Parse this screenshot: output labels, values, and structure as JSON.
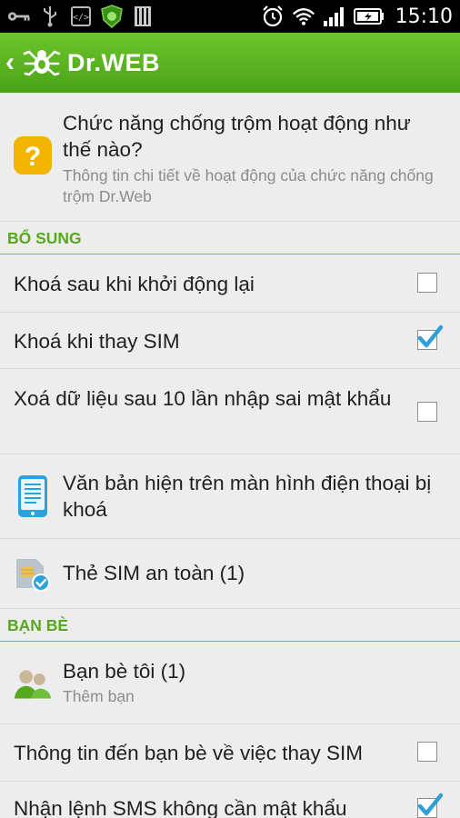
{
  "status_bar": {
    "time": "15:10",
    "left_icons": [
      "key-icon",
      "usb-icon",
      "code-icon",
      "drweb-shield-icon",
      "storage-icon"
    ],
    "right_icons": [
      "alarm-icon",
      "wifi-icon",
      "signal-icon",
      "battery-icon"
    ]
  },
  "action_bar": {
    "brand": "Dr.WEB",
    "back_glyph": "‹"
  },
  "help_item": {
    "title": "Chức năng chống trộm hoạt động như thế nào?",
    "subtitle": "Thông tin chi tiết về hoạt động của chức năng chống trộm Dr.Web"
  },
  "sections": {
    "extra": "BỔ SUNG",
    "friends": "BẠN BÈ"
  },
  "settings": [
    {
      "label": "Khoá sau khi khởi động lại",
      "checked": false
    },
    {
      "label": "Khoá khi thay SIM",
      "checked": true
    },
    {
      "label": "Xoá dữ liệu sau 10 lần nhập sai mật khẩu",
      "checked": false
    }
  ],
  "lock_text_item": {
    "title": "Văn bản hiện trên màn hình điện thoại bị khoá"
  },
  "sim_item": {
    "title": "Thẻ SIM an toàn (1)"
  },
  "friends_item": {
    "title": "Bạn bè tôi (1)",
    "subtitle": "Thêm bạn"
  },
  "friend_settings": [
    {
      "label": "Thông tin đến bạn bè về việc thay SIM",
      "checked": false
    },
    {
      "label": "Nhận lệnh SMS không cần mật khẩu",
      "checked": true
    }
  ],
  "colors": {
    "accent": "#57a81f",
    "actionbar": "#4aa318",
    "help_icon": "#f3b400",
    "check": "#2f9fd8"
  }
}
